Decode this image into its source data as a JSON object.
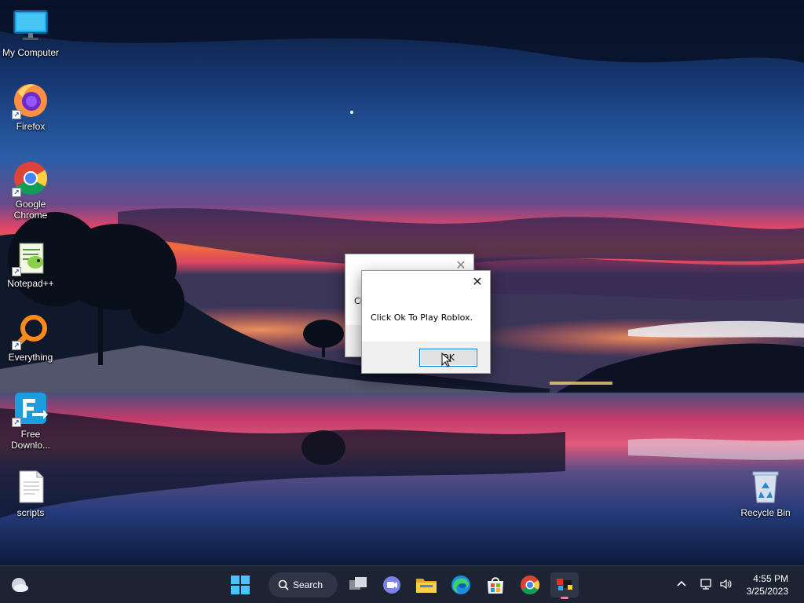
{
  "desktop": {
    "icons": [
      {
        "label": "My Computer"
      },
      {
        "label": "Firefox"
      },
      {
        "label": "Google Chrome"
      },
      {
        "label": "Notepad++"
      },
      {
        "label": "Everything"
      },
      {
        "label": "Free Downlo..."
      },
      {
        "label": "scripts"
      },
      {
        "label": "Recycle Bin"
      }
    ]
  },
  "back_dialog": {
    "message_fragment": "Cl",
    "close_glyph": "✕"
  },
  "front_dialog": {
    "message": "Click Ok To Play Roblox.",
    "ok_label": "OK",
    "close_glyph": "✕"
  },
  "taskbar": {
    "search_label": "Search",
    "items": [
      "start-icon",
      "search",
      "task-view-icon",
      "teams-chat-icon",
      "file-explorer-icon",
      "edge-icon",
      "store-icon",
      "chrome-icon",
      "roblox-app-icon"
    ],
    "clock": {
      "time": "4:55 PM",
      "date": "3/25/2023"
    }
  },
  "colors": {
    "accent": "#0078d7",
    "taskbar": "#1c2434"
  }
}
